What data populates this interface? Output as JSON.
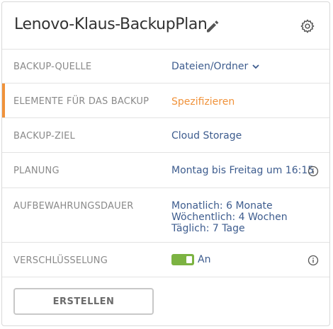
{
  "plan": {
    "title": "Lenovo-Klaus-BackupPlan"
  },
  "rows": [
    {
      "label": "BACKUP-QUELLE",
      "value": "Dateien/Ordner"
    },
    {
      "label": "ELEMENTE FÜR DAS BACKUP",
      "value": "Spezifizieren"
    },
    {
      "label": "BACKUP-ZIEL",
      "value": "Cloud Storage"
    },
    {
      "label": "PLANUNG",
      "value": "Montag bis Freitag um 16:15"
    },
    {
      "label": "AUFBEWAHRUNGSDAUER",
      "lines": [
        "Monatlich: 6 Monate",
        "Wöchentlich: 4 Wochen",
        "Täglich: 7 Tage"
      ]
    },
    {
      "label": "VERSCHLÜSSELUNG",
      "toggle_state": "An"
    }
  ],
  "actions": {
    "create_label": "ERSTELLEN"
  },
  "colors": {
    "accent_orange": "#f0923a",
    "link_blue": "#3d5c8e",
    "toggle_green": "#7cb342"
  },
  "icons": [
    "pencil-icon",
    "gear-icon",
    "chevron-down-icon",
    "info-icon"
  ]
}
